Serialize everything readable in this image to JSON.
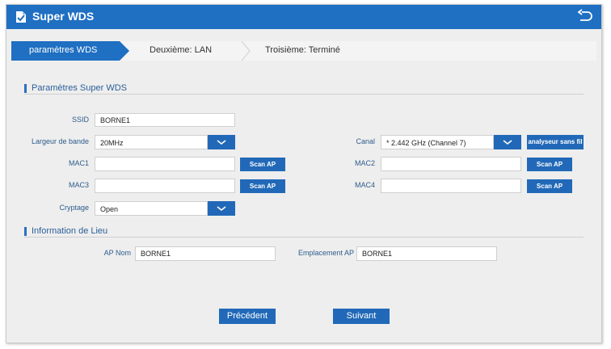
{
  "app": {
    "title": "Super WDS",
    "logo_icon": "document-icon",
    "back_icon": "return-arrow-icon"
  },
  "steps": [
    {
      "label": "paramètres WDS",
      "active": true
    },
    {
      "label": "Deuxième: LAN",
      "active": false
    },
    {
      "label": "Troisième: Terminé",
      "active": false
    }
  ],
  "section_wds": {
    "heading": "Paramètres Super WDS",
    "ssid_label": "SSID",
    "ssid_value": "BORNE1",
    "bandwidth_label": "Largeur de bande",
    "bandwidth_value": "20MHz",
    "channel_label": "Canal",
    "channel_value": "* 2.442 GHz (Channel 7)",
    "analyzer_button": "analyseur sans fil",
    "mac1_label": "MAC1",
    "mac1_value": "",
    "mac2_label": "MAC2",
    "mac2_value": "",
    "mac3_label": "MAC3",
    "mac3_value": "",
    "mac4_label": "MAC4",
    "mac4_value": "",
    "scan_button": "Scan AP",
    "crypt_label": "Cryptage",
    "crypt_value": "Open"
  },
  "section_location": {
    "heading": "Information de Lieu",
    "ap_name_label": "AP Nom",
    "ap_name_value": "BORNE1",
    "ap_location_label": "Emplacement AP",
    "ap_location_value": "BORNE1"
  },
  "footer": {
    "prev_button": "Précédent",
    "next_button": "Suivant"
  },
  "colors": {
    "titlebar": "#1f6fc2",
    "accent": "#2169b8",
    "label": "#2d5c8c"
  }
}
